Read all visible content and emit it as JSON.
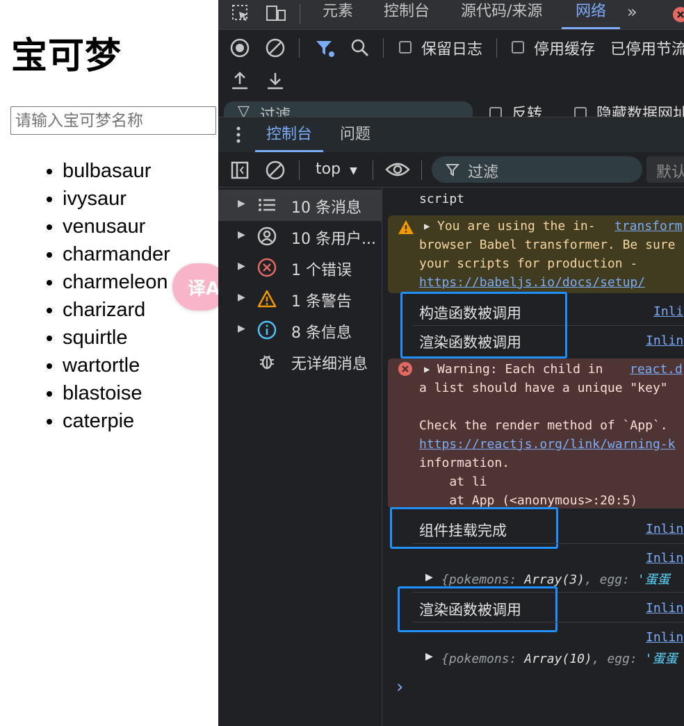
{
  "app": {
    "title": "宝可梦",
    "search_placeholder": "请输入宝可梦名称",
    "pokemon": [
      "bulbasaur",
      "ivysaur",
      "venusaur",
      "charmander",
      "charmeleon",
      "charizard",
      "squirtle",
      "wartortle",
      "blastoise",
      "caterpie"
    ],
    "translate_icon_glyph": "译A"
  },
  "devtools": {
    "tabs": [
      "元素",
      "控制台",
      "源代码/来源",
      "网络"
    ],
    "active_tab": "网络",
    "more_tabs_glyph": "»",
    "network_toolbar": {
      "preserve_log": "保留日志",
      "disable_cache": "停用缓存",
      "throttling": "已停用节流",
      "filter_peek": "过滤",
      "invert": "反转",
      "hide_data_urls": "隐藏数据网址"
    },
    "drawer_tabs": [
      "控制台",
      "问题"
    ],
    "drawer_active": "控制台",
    "console_toolbar": {
      "context": "top",
      "filter_placeholder": "过滤",
      "levels": "默认"
    },
    "sidebar": [
      {
        "label": "10 条消息",
        "icon": "list-icon"
      },
      {
        "label": "10 条用户...",
        "icon": "user-icon"
      },
      {
        "label": "1 个错误",
        "icon": "error-icon"
      },
      {
        "label": "1 条警告",
        "icon": "warning-icon"
      },
      {
        "label": "8 条信息",
        "icon": "info-icon"
      },
      {
        "label": "无详细消息",
        "icon": "bug-icon"
      }
    ],
    "messages": {
      "top_line": "script",
      "warning": {
        "line1": "You are using the in-",
        "source": "transform",
        "line2": "browser Babel transformer. Be sure",
        "line3": "your scripts for production -",
        "link": "https://babeljs.io/docs/setup/"
      },
      "log1": {
        "text": "构造函数被调用",
        "source": "Inli"
      },
      "log2": {
        "text": "渲染函数被调用",
        "source": "Inlin"
      },
      "error": {
        "line1": "Warning: Each child in",
        "source": "react.d",
        "line2": "a list should have a unique \"key\"",
        "line3": "Check the render method of `App`.",
        "link": "https://reactjs.org/link/warning-k",
        "line4": "information.",
        "line5": "    at li",
        "line6": "    at App (<anonymous>:20:5)"
      },
      "log3": {
        "text": "组件挂载完成",
        "source": "Inlin"
      },
      "obj1": {
        "source": "Inlin",
        "key1": "pokemons",
        "val1": "Array(3)",
        "key2": "egg",
        "val2": "'蛋蛋"
      },
      "log4": {
        "text": "渲染函数被调用",
        "source": "Inlin"
      },
      "obj2": {
        "source": "Inlin",
        "key1": "pokemons",
        "val1": "Array(10)",
        "key2": "egg",
        "val2": "'蛋蛋"
      },
      "prompt": "›"
    },
    "highlight_color": "#1e90ff"
  }
}
